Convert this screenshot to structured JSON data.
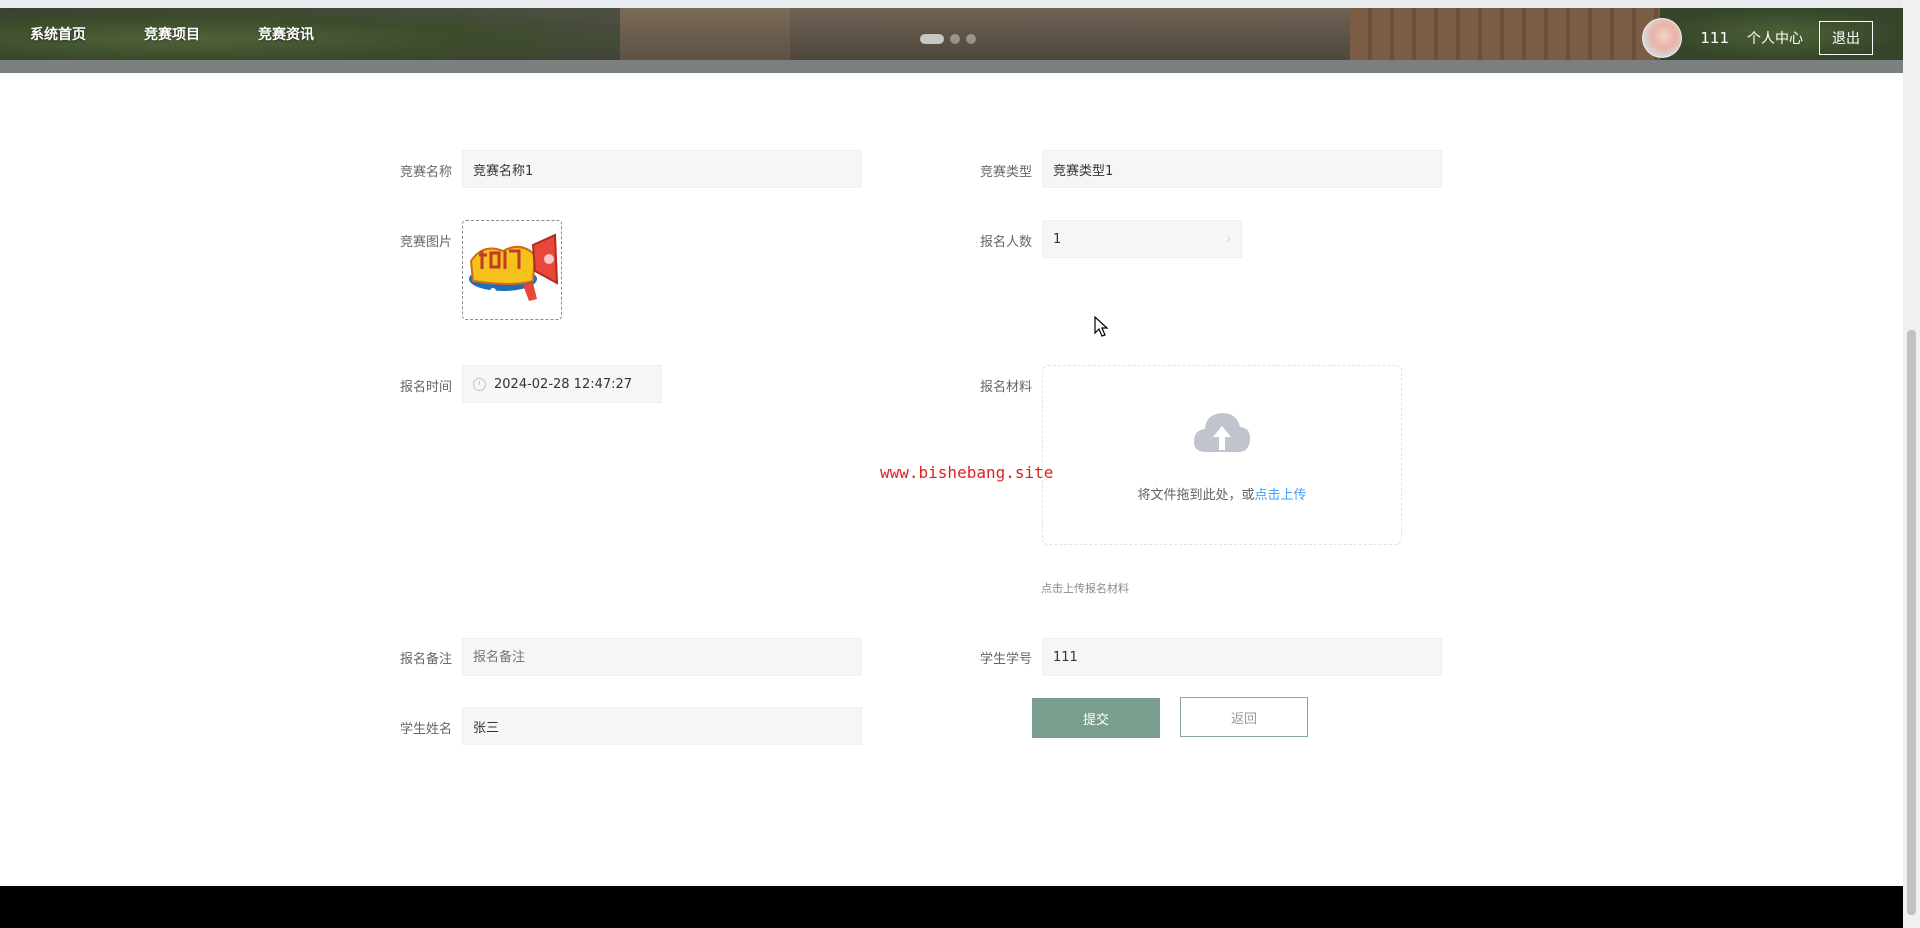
{
  "nav": {
    "items": [
      {
        "label": "系统首页"
      },
      {
        "label": "竞赛项目"
      },
      {
        "label": "竞赛资讯"
      }
    ]
  },
  "user": {
    "name": "111",
    "center_label": "个人中心",
    "logout_label": "退出"
  },
  "form": {
    "competition_name": {
      "label": "竞赛名称",
      "value": "竞赛名称1"
    },
    "competition_type": {
      "label": "竞赛类型",
      "value": "竞赛类型1"
    },
    "competition_image": {
      "label": "竞赛图片",
      "image_text": "知识竞赛"
    },
    "participant_count": {
      "label": "报名人数",
      "value": "1"
    },
    "signup_time": {
      "label": "报名时间",
      "value": "2024-02-28 12:47:27"
    },
    "signup_material": {
      "label": "报名材料",
      "drop_text": "将文件拖到此处，或",
      "link_text": "点击上传",
      "tip": "点击上传报名材料"
    },
    "signup_note": {
      "label": "报名备注",
      "placeholder": "报名备注"
    },
    "student_no": {
      "label": "学生学号",
      "value": "111"
    },
    "student_name": {
      "label": "学生姓名",
      "value": "张三"
    }
  },
  "buttons": {
    "submit": "提交",
    "back": "返回"
  },
  "watermark": "www.bishebang.site",
  "colors": {
    "accent": "#7a9e8e",
    "link": "#409eff",
    "watermark": "#e01f1f"
  }
}
